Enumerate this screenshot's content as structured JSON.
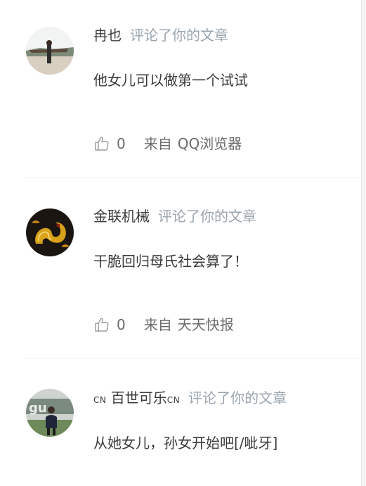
{
  "comments": [
    {
      "user": "冉也",
      "cn_prefix": "",
      "cn_suffix": "",
      "action": "评论了你的文章",
      "text": "他女儿可以做第一个试试",
      "likes": "0",
      "from_label": "来自",
      "source": "QQ浏览器",
      "avatar_icon": "landscape-photo-avatar"
    },
    {
      "user": "金联机械",
      "cn_prefix": "",
      "cn_suffix": "",
      "action": "评论了你的文章",
      "text": "干脆回归母氏社会算了！",
      "likes": "0",
      "from_label": "来自",
      "source": "天天快报",
      "avatar_icon": "golden-dragon-avatar"
    },
    {
      "user": "百世可乐",
      "cn_prefix": "CN",
      "cn_suffix": "CN",
      "action": "评论了你的文章",
      "text": "从她女儿，孙女开始吧[/呲牙]",
      "avatar_icon": "person-photo-avatar"
    }
  ],
  "colors": {
    "name": "#3c3c3c",
    "action": "#9aa5ae",
    "meta": "#6b6b6b",
    "divider": "#eeeeee"
  },
  "icons": {
    "like": "thumbs-up-icon"
  }
}
